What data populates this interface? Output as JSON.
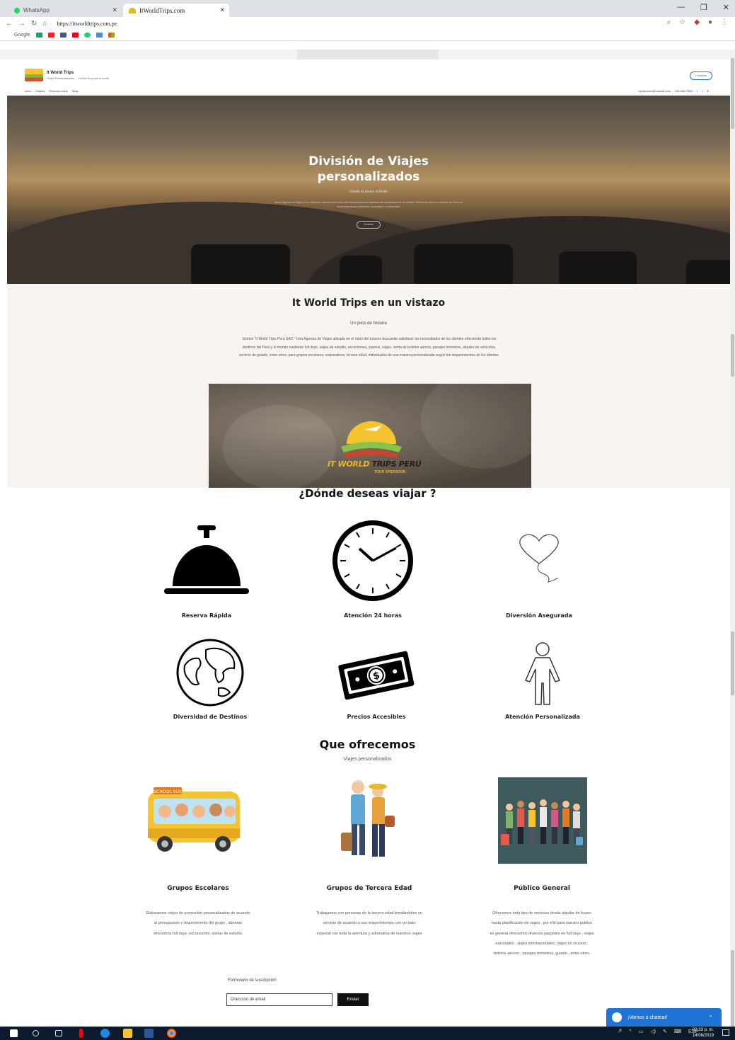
{
  "browser": {
    "tabs": [
      {
        "label": "WhatsApp"
      },
      {
        "label": "ItWorldTrips.com"
      }
    ],
    "url": "https://itworldtrips.com.pe",
    "bookmarks_label": "Google"
  },
  "site": {
    "name": "It World Trips",
    "tagline": "Viajes Personalizados ... Donde tu pones el límite",
    "contact_button": "Contacto",
    "nav": [
      "Inicio",
      "Galeria",
      "Reserva online",
      "Blog"
    ],
    "email": "ttyservicios@hotmail.com",
    "phone": "106-456-7890"
  },
  "hero": {
    "title_line1": "División de Viajes",
    "title_line2": "personalizados",
    "subtitle": "Donde tú pones el límite",
    "text": "Somos Agencia de Viajes y Tour Operador ubicados en el rubro del turismo buscando satisfacer las necesidades de los clientes. Ofrecemos todos los destinos del Perú y el mundo para grupos escolares, corporativos e individuales.",
    "button": "Contacto"
  },
  "about": {
    "title": "It World Trips en un vistazo",
    "subtitle": "Un poco de historia",
    "text": "Somos \"It World Trips Perú SAC.\" Una Agencia de Viajes ubicada en el rubro del turismo buscando satisfacer las necesidades de los clientes ofreciendo todos los destinos del Perú y el mundo mediante full days, viajes de estudio, excursiones, paseos, viajes, venta de boletos aéreos, pasajes terrestres, alquiler de vehículos, servicio de guiado, entre otros, para grupos escolares, corporativos, tercera edad, individuales de una manera personalizada según los requerimientos de los clientes.",
    "brand_part1": "IT WORLD",
    "brand_part2": "TRIPS PERÚ",
    "brand_sub": "TOUR OPERADOR"
  },
  "features": {
    "title": "¿Dónde deseas viajar ?",
    "items": [
      {
        "label": "Reserva Rápida",
        "icon": "service-bell-icon"
      },
      {
        "label": "Atención 24 horas",
        "icon": "clock-icon"
      },
      {
        "label": "Diversión Asegurada",
        "icon": "heart-balloon-icon"
      },
      {
        "label": "Diversidad de Destinos",
        "icon": "globe-icon"
      },
      {
        "label": "Precios Accesibles",
        "icon": "money-bill-icon"
      },
      {
        "label": "Atención Personalizada",
        "icon": "person-icon"
      }
    ]
  },
  "offers": {
    "title": "Que ofrecemos",
    "subtitle": "Viajes personalizados",
    "items": [
      {
        "title": "Grupos Escolares",
        "text": "Elaboramos viajes de promoción personalizados de acuerdo al presupuesto y requerimiento del grupo , ademas ofrecemos full days, excursiones, visitas de estudio.",
        "image_label": "SCHOOL BUS"
      },
      {
        "title": "Grupos de Tercera Edad",
        "text": "Trabajamos con personas de la tercera edad brindándoles un servicio de acuerdo a sus requerimientos con un trato especial con toda la aventura y adrenalina de nuestros viajes"
      },
      {
        "title": "Público General",
        "text": "Ofrecemos todo tipo de servicios desde alquiler de buses hasta planificación de viajes , por ello para nuestro publico en general ofrecemos diversos paquetes en full days , viajes nacionales , viajes internacionales, viajes en crucero , boletos aéreos , pasajes terrestres, guiado , entre otros."
      }
    ]
  },
  "subscribe": {
    "label": "Formulario de suscripción",
    "placeholder": "Dirección de email",
    "button": "Enviar"
  },
  "chat": {
    "label": "¡Vamos a chatear!"
  },
  "taskbar": {
    "lang": "ESP",
    "time": "02:33 p. m.",
    "date": "14/06/2019"
  },
  "colors": {
    "accent_blue": "#1f74d6",
    "brand_yellow": "#e9b52a"
  }
}
